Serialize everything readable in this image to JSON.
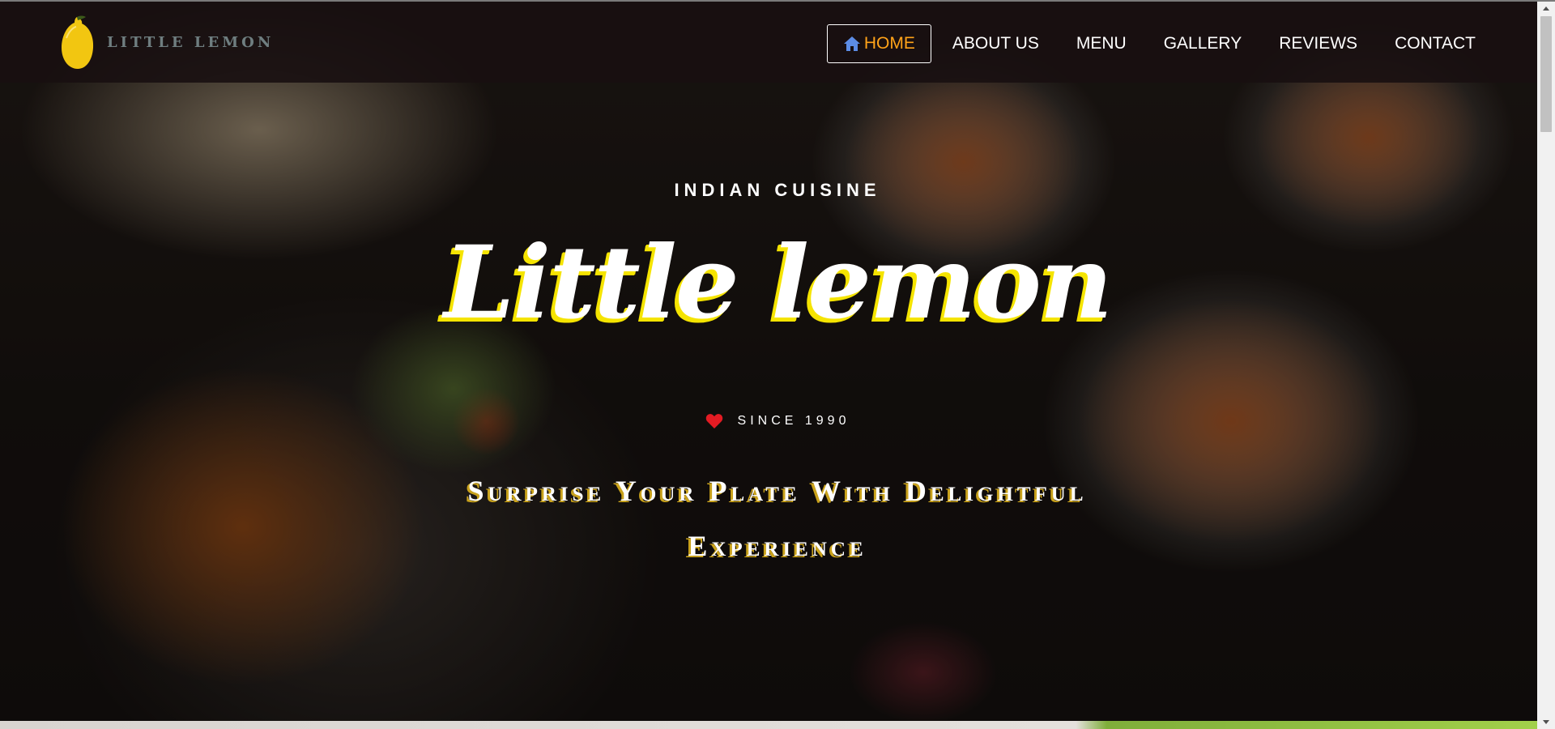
{
  "brand": {
    "name": "LITTLE LEMON",
    "logo_icon": "lemon-icon",
    "colors": {
      "logo_text": "#6f7e80",
      "lemon": "#f2c611"
    }
  },
  "nav": {
    "items": [
      {
        "label": "HOME",
        "icon": "home-icon",
        "active": true
      },
      {
        "label": "ABOUT US",
        "active": false
      },
      {
        "label": "MENU",
        "active": false
      },
      {
        "label": "GALLERY",
        "active": false
      },
      {
        "label": "REVIEWS",
        "active": false
      },
      {
        "label": "CONTACT",
        "active": false
      }
    ],
    "colors": {
      "active_text": "#ffa319",
      "text": "#ffffff",
      "home_icon": "#5c8de6"
    }
  },
  "hero": {
    "eyebrow": "INDIAN CUISINE",
    "title": "Little lemon",
    "since_icon": "heart-icon",
    "since": "SINCE 1990",
    "tagline_line1": "Surprise Your Plate With Delightful",
    "tagline_line2": "Experience",
    "colors": {
      "title_shadow": "#f5e400",
      "heart": "#e31b23",
      "tagline_shadow": "#c9a21c"
    }
  }
}
